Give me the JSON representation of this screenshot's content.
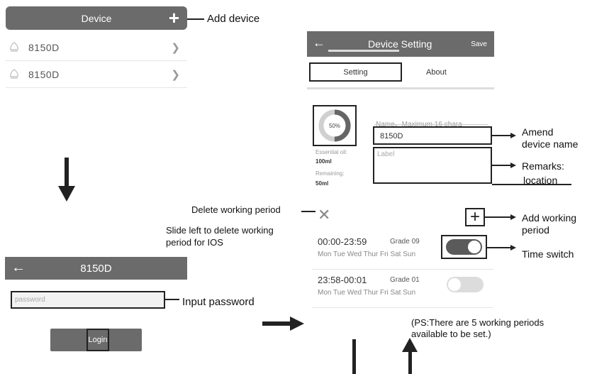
{
  "device_list": {
    "header_title": "Device",
    "items": [
      {
        "name": "8150D"
      },
      {
        "name": "8150D"
      }
    ]
  },
  "login": {
    "title": "8150D",
    "password_placeholder": "password",
    "button_label": "Login"
  },
  "device_setting": {
    "title": "Device Setting",
    "save_label": "Save",
    "tabs": {
      "setting": "Setting",
      "about": "About"
    },
    "gauge_percent_label": "50%",
    "gauge_percent": 50,
    "essential_oil_label": "Essential oil:",
    "essential_oil_value": "100ml",
    "remaining_label": "Remaining:",
    "remaining_value": "50ml",
    "name_hint": "Name、Maximum 16 chara",
    "name_value": "8150D",
    "label_placeholder": "Label",
    "periods": [
      {
        "time": "00:00-23:59",
        "grade": "Grade  09",
        "days": "Mon Tue Wed Thur Fri Sat Sun",
        "enabled": true
      },
      {
        "time": "23:58-00:01",
        "grade": "Grade  01",
        "days": "Mon Tue Wed Thur Fri Sat Sun",
        "enabled": false
      }
    ]
  },
  "annotations": {
    "add_device": "Add device",
    "input_password": "Input password",
    "amend_name_1": "Amend",
    "amend_name_2": "device name",
    "remarks_1": "Remarks:",
    "remarks_2": "location",
    "delete_period": "Delete working period",
    "slide_left_1": "Slide left to delete working",
    "slide_left_2": "period for IOS",
    "add_period_1": "Add working",
    "add_period_2": "period",
    "time_switch": "Time switch",
    "ps_1": "(PS:There are 5 working periods",
    "ps_2": "available to be set.)"
  },
  "colors": {
    "header_gray": "#6b6b6b",
    "outline": "#222222"
  }
}
